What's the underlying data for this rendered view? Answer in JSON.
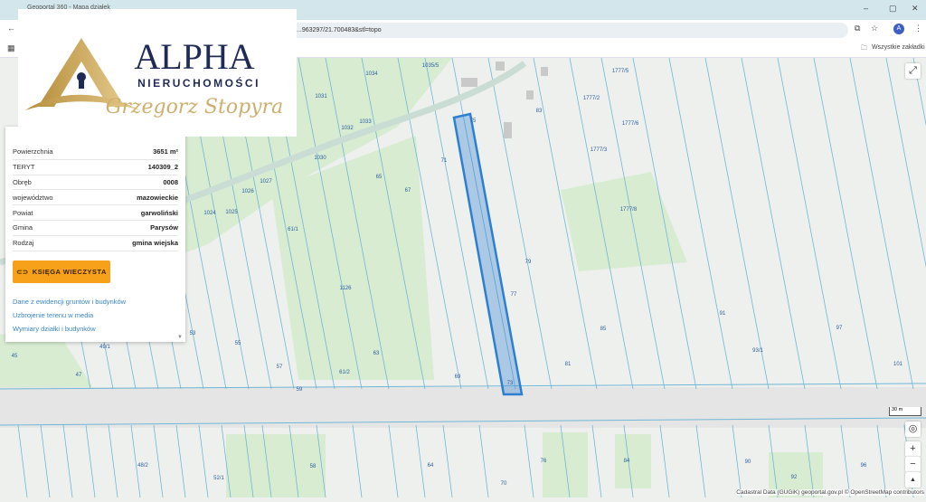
{
  "browser": {
    "tab_title": "Geoportal 360 - Mapa działek",
    "url": "...963297/21.700483&stl=topo",
    "bookmarks_label": "Wszystkie zakładki",
    "profile_initial": "A",
    "minimize": "–",
    "restore": "▢",
    "close": "✕"
  },
  "logo": {
    "brand": "ALPHA",
    "sub": "NIERUCHOMOŚCI",
    "name": "Grzegorz Stopyra"
  },
  "panel": {
    "rows": [
      {
        "label": "Powierzchnia",
        "value": "3651 m²"
      },
      {
        "label": "TERYT",
        "value": "140309_2"
      },
      {
        "label": "Obręb",
        "value": "0008"
      },
      {
        "label": "województwo",
        "value": "mazowieckie"
      },
      {
        "label": "Powiat",
        "value": "garwoliński"
      },
      {
        "label": "Gmina",
        "value": "Parysów"
      },
      {
        "label": "Rodzaj",
        "value": "gmina wiejska"
      }
    ],
    "kw_button": "KSIĘGA WIECZYSTA",
    "links": [
      "Dane z ewidencji gruntów i budynków",
      "Uzbrojenie terenu w media",
      "Wymiary działki i budynków"
    ]
  },
  "map": {
    "parcels": [
      "1035/5",
      "1034",
      "1031",
      "1033",
      "1032",
      "1030",
      "75",
      "83",
      "1777/5",
      "1777/2",
      "1777/6",
      "1777/3",
      "71",
      "65",
      "67",
      "1027",
      "1026",
      "1024",
      "1025",
      "61/1",
      "1777/8",
      "79",
      "77",
      "1126",
      "91",
      "85",
      "97",
      "93/1",
      "53",
      "55",
      "49/1",
      "45",
      "47",
      "57",
      "63",
      "61/2",
      "69",
      "81",
      "59",
      "73",
      "101",
      "48/2",
      "52/1",
      "58",
      "64",
      "70",
      "76",
      "84",
      "90",
      "92",
      "96"
    ],
    "scale": "30 m",
    "attribution": "Cadastral Data (GUGiK) geoportal.gov.pl © OpenStreetMap contributors",
    "zoom_in": "+",
    "zoom_out": "−",
    "compass": "▲",
    "locate": "◎",
    "fullscreen": "⤢"
  },
  "colors": {
    "parcel_line": "#6fb7d6",
    "selected": "#2d7fd0",
    "green": "#d8ecd2",
    "button": "#f7a11a"
  }
}
